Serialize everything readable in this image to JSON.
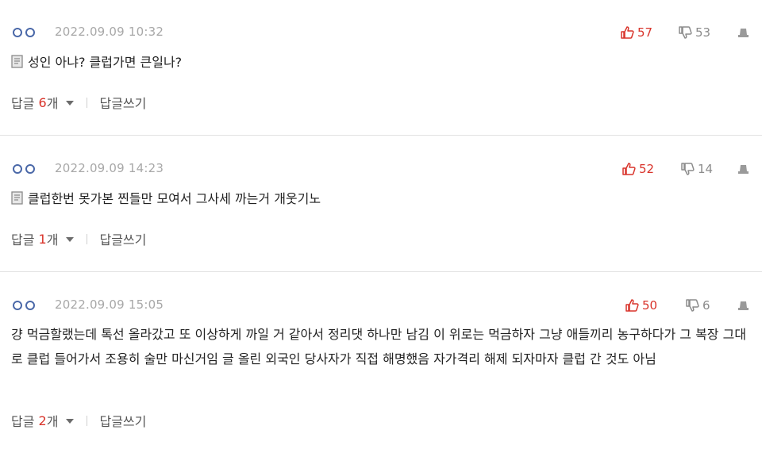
{
  "comments": [
    {
      "date": "2022.09.09 10:32",
      "likes": "57",
      "dislikes": "53",
      "text": "성인 아냐? 클럽가면 큰일나?",
      "has_mark": true,
      "reply_label": "답글",
      "reply_count": "6",
      "reply_unit": "개",
      "write_label": "답글쓰기"
    },
    {
      "date": "2022.09.09 14:23",
      "likes": "52",
      "dislikes": "14",
      "text": "클럽한번 못가본 찐들만 모여서 그사세 까는거 개웃기노",
      "has_mark": true,
      "reply_label": "답글",
      "reply_count": "1",
      "reply_unit": "개",
      "write_label": "답글쓰기"
    },
    {
      "date": "2022.09.09 15:05",
      "likes": "50",
      "dislikes": "6",
      "text": "걍 먹금할랬는데 톡선 올라갔고 또 이상하게 까일 거 같아서 정리댓 하나만 남김 이 위로는 먹금하자 그냥 애들끼리 농구하다가 그 복장 그대로 클럽 들어가서 조용히 술만 마신거임 글 올린 외국인 당사자가 직접 해명했음 자가격리 해제 되자마자 클럽 간 것도 아님",
      "has_mark": false,
      "reply_label": "답글",
      "reply_count": "2",
      "reply_unit": "개",
      "write_label": "답글쓰기"
    }
  ]
}
